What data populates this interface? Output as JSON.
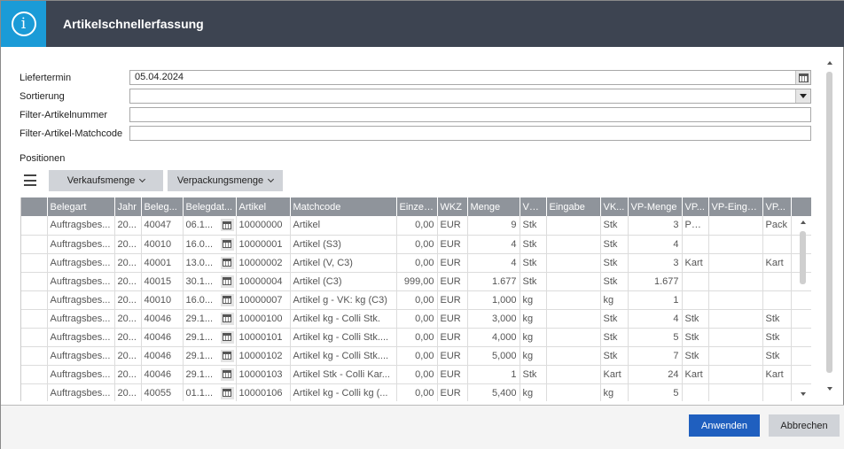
{
  "window": {
    "title": "Artikelschnellerfassung"
  },
  "form": {
    "liefertermin_label": "Liefertermin",
    "liefertermin_value": "05.04.2024",
    "sortierung_label": "Sortierung",
    "sortierung_value": "",
    "filter_artikelnummer_label": "Filter-Artikelnummer",
    "filter_artikelnummer_value": "",
    "filter_matchcode_label": "Filter-Artikel-Matchcode",
    "filter_matchcode_value": ""
  },
  "positions": {
    "label": "Positionen",
    "toolbar": {
      "verkaufsmenge": "Verkaufsmenge",
      "verpackungsmenge": "Verpackungsmenge"
    },
    "columns": [
      "",
      "Belegart",
      "Jahr",
      "Beleg...",
      "Belegdat...",
      "Artikel",
      "Matchcode",
      "Einzel...",
      "WKZ",
      "Menge",
      "VK...",
      "Eingabe",
      "VK...",
      "VP-Menge",
      "VP...",
      "VP-Einga...",
      "VP...",
      ""
    ],
    "rows": [
      [
        "",
        "Auftragsbes...",
        "20...",
        "40047",
        "06.1...",
        "10000000",
        "Artikel",
        "0,00",
        "EUR",
        "9",
        "Stk",
        "",
        "Stk",
        "3",
        "Pack",
        "",
        "Pack"
      ],
      [
        "",
        "Auftragsbes...",
        "20...",
        "40010",
        "16.0...",
        "10000001",
        "Artikel (S3)",
        "0,00",
        "EUR",
        "4",
        "Stk",
        "",
        "Stk",
        "4",
        "",
        "",
        ""
      ],
      [
        "",
        "Auftragsbes...",
        "20...",
        "40001",
        "13.0...",
        "10000002",
        "Artikel (V, C3)",
        "0,00",
        "EUR",
        "4",
        "Stk",
        "",
        "Stk",
        "3",
        "Kart",
        "",
        "Kart"
      ],
      [
        "",
        "Auftragsbes...",
        "20...",
        "40015",
        "30.1...",
        "10000004",
        "Artikel (C3)",
        "999,00",
        "EUR",
        "1.677",
        "Stk",
        "",
        "Stk",
        "1.677",
        "",
        "",
        ""
      ],
      [
        "",
        "Auftragsbes...",
        "20...",
        "40010",
        "16.0...",
        "10000007",
        "Artikel g - VK: kg (C3)",
        "0,00",
        "EUR",
        "1,000",
        "kg",
        "",
        "kg",
        "1",
        "",
        "",
        ""
      ],
      [
        "",
        "Auftragsbes...",
        "20...",
        "40046",
        "29.1...",
        "10000100",
        "Artikel kg - Colli Stk.",
        "0,00",
        "EUR",
        "3,000",
        "kg",
        "",
        "Stk",
        "4",
        "Stk",
        "",
        "Stk"
      ],
      [
        "",
        "Auftragsbes...",
        "20...",
        "40046",
        "29.1...",
        "10000101",
        "Artikel kg - Colli Stk....",
        "0,00",
        "EUR",
        "4,000",
        "kg",
        "",
        "Stk",
        "5",
        "Stk",
        "",
        "Stk"
      ],
      [
        "",
        "Auftragsbes...",
        "20...",
        "40046",
        "29.1...",
        "10000102",
        "Artikel kg - Colli Stk....",
        "0,00",
        "EUR",
        "5,000",
        "kg",
        "",
        "Stk",
        "7",
        "Stk",
        "",
        "Stk"
      ],
      [
        "",
        "Auftragsbes...",
        "20...",
        "40046",
        "29.1...",
        "10000103",
        "Artikel Stk - Colli Kar...",
        "0,00",
        "EUR",
        "1",
        "Stk",
        "",
        "Kart",
        "24",
        "Kart",
        "",
        "Kart"
      ],
      [
        "",
        "Auftragsbes...",
        "20...",
        "40055",
        "01.1...",
        "10000106",
        "Artikel kg - Colli kg (...",
        "0,00",
        "EUR",
        "5,400",
        "kg",
        "",
        "kg",
        "5",
        "",
        "",
        ""
      ]
    ]
  },
  "footer": {
    "apply": "Anwenden",
    "cancel": "Abbrechen"
  },
  "colors": {
    "titlebar": "#3d4451",
    "info_accent": "#1b9bd7",
    "grid_header": "#8f949b",
    "apply_button": "#1f5fbf"
  },
  "icons": [
    "info-icon",
    "calendar-icon",
    "dropdown-arrow-icon",
    "menu-icon",
    "chevron-down-icon"
  ]
}
